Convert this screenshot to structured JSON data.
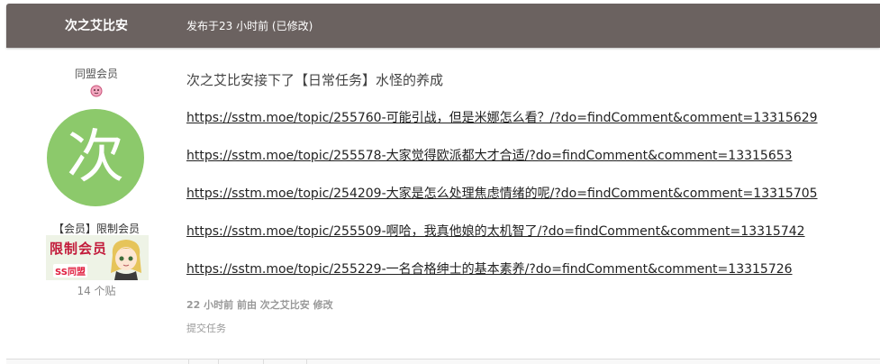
{
  "header": {
    "author": "次之艾比安",
    "meta": "发布于23 小时前 (已修改)"
  },
  "author_panel": {
    "group_title": "同盟会员",
    "group_icon": "group-member-icon",
    "avatar_letter": "次",
    "avatar_color": "#8cc96b",
    "member_group": "【会员】限制会员",
    "rank_image_text": "限制会员",
    "rank_image_sub": "SS同盟",
    "post_count": "14 个贴"
  },
  "post": {
    "intro": "次之艾比安接下了【日常任务】水怪的养成",
    "links": [
      "https://sstm.moe/topic/255760-可能引战，但是米娜怎么看？/?do=findComment&comment=13315629",
      "https://sstm.moe/topic/255578-大家觉得欧派都大才合适/?do=findComment&comment=13315653",
      "https://sstm.moe/topic/254209-大家是怎么处理焦虑情绪的呢/?do=findComment&comment=13315705",
      "https://sstm.moe/topic/255509-啊哈，我真他娘的太机智了/?do=findComment&comment=13315742",
      "https://sstm.moe/topic/255229-一名合格绅士的基本素养/?do=findComment&comment=13315726"
    ],
    "edit_note": "22 小时前 前由 次之艾比安 修改",
    "submit_task": "提交任务"
  },
  "colors": {
    "header_bg": "#6b6260",
    "link": "#222222"
  }
}
